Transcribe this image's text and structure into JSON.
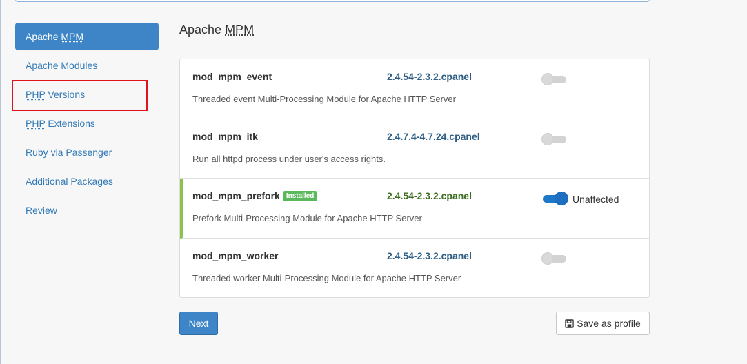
{
  "sidebar": {
    "items": [
      {
        "prefix": "Apache ",
        "abbr": "MPM",
        "suffix": ""
      },
      {
        "prefix": "Apache Modules",
        "abbr": "",
        "suffix": ""
      },
      {
        "prefix": "",
        "abbr": "PHP",
        "suffix": " Versions"
      },
      {
        "prefix": "",
        "abbr": "PHP",
        "suffix": " Extensions"
      },
      {
        "prefix": "Ruby via Passenger",
        "abbr": "",
        "suffix": ""
      },
      {
        "prefix": "Additional Packages",
        "abbr": "",
        "suffix": ""
      },
      {
        "prefix": "Review",
        "abbr": "",
        "suffix": ""
      }
    ]
  },
  "main": {
    "title_prefix": "Apache ",
    "title_abbr": "MPM",
    "modules": [
      {
        "name": "mod_mpm_event",
        "badge": "",
        "version": "2.4.54-2.3.2.cpanel",
        "description": "Threaded event Multi-Processing Module for Apache HTTP Server",
        "enabled": false,
        "status": ""
      },
      {
        "name": "mod_mpm_itk",
        "badge": "",
        "version": "2.4.7.4-4.7.24.cpanel",
        "description": "Run all httpd process under user's access rights.",
        "enabled": false,
        "status": ""
      },
      {
        "name": "mod_mpm_prefork",
        "badge": "Installed",
        "version": "2.4.54-2.3.2.cpanel",
        "description": "Prefork Multi-Processing Module for Apache HTTP Server",
        "enabled": true,
        "status": "Unaffected"
      },
      {
        "name": "mod_mpm_worker",
        "badge": "",
        "version": "2.4.54-2.3.2.cpanel",
        "description": "Threaded worker Multi-Processing Module for Apache HTTP Server",
        "enabled": false,
        "status": ""
      }
    ]
  },
  "buttons": {
    "next_label": "Next",
    "save_profile_label": "Save as profile"
  },
  "colors": {
    "accent": "#3d85c6",
    "installed_border": "#8bc34a",
    "badge_green": "#5cb85c",
    "highlight_red": "#e0131c",
    "toggle_on": "#1e78c8"
  },
  "icons": {
    "save": "floppy-disk-icon"
  }
}
